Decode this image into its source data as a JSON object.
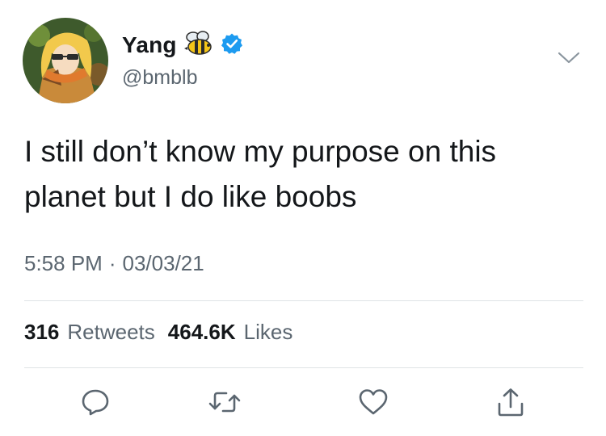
{
  "tweet": {
    "display_name": "Yang",
    "handle": "@bmblb",
    "verified": true,
    "text": "I still don’t know my purpose on this\nplanet but I do like boobs",
    "time": "5:58 PM",
    "separator": "·",
    "date": "03/03/21",
    "retweets_count": "316",
    "retweets_label": "Retweets",
    "likes_count": "464.6K",
    "likes_label": "Likes"
  },
  "icons": {
    "bee": "bee-icon",
    "verified": "verified-badge-icon",
    "menu": "chevron-down-icon",
    "reply": "reply-icon",
    "retweet": "retweet-icon",
    "like": "heart-icon",
    "share": "share-icon"
  },
  "colors": {
    "text_primary": "#14171a",
    "text_secondary": "#5b6670",
    "verified_blue": "#1d9bf0",
    "divider": "#dfe3e6",
    "icon_gray": "#5b6670"
  }
}
